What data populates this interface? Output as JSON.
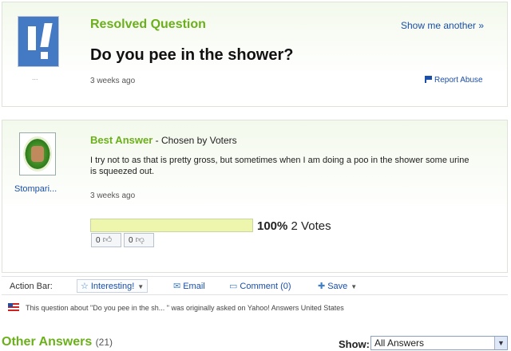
{
  "question": {
    "status": "Resolved Question",
    "title": "Do you pee in the shower?",
    "time": "3 weeks ago",
    "avatar_caption": "...",
    "show_another": "Show me another »",
    "report_abuse": "Report Abuse"
  },
  "best_answer": {
    "label": "Best Answer",
    "chosen_by": " - Chosen by Voters",
    "text": "I try not to as that is pretty gross, but sometimes when I am doing a poo in the shower some urine is squeezed out.",
    "time": "3 weeks ago",
    "user": "Stompari...",
    "vote_percent": "100%",
    "vote_percent_value": 1.0,
    "votes_text": "2 Votes",
    "thumbs_up": "0",
    "thumbs_down": "0"
  },
  "action_bar": {
    "label": "Action Bar:",
    "interesting": "Interesting!",
    "email": "Email",
    "comment": "Comment (0)",
    "save": "Save"
  },
  "origin": "This question about \"Do you pee in the sh... \" was originally asked on Yahoo! Answers United States",
  "other_answers": {
    "title": "Other Answers",
    "count": "(21)",
    "show_label": "Show:",
    "show_value": "All Answers"
  },
  "colors": {
    "green": "#6bb01a",
    "link_blue": "#1b4ea8"
  }
}
